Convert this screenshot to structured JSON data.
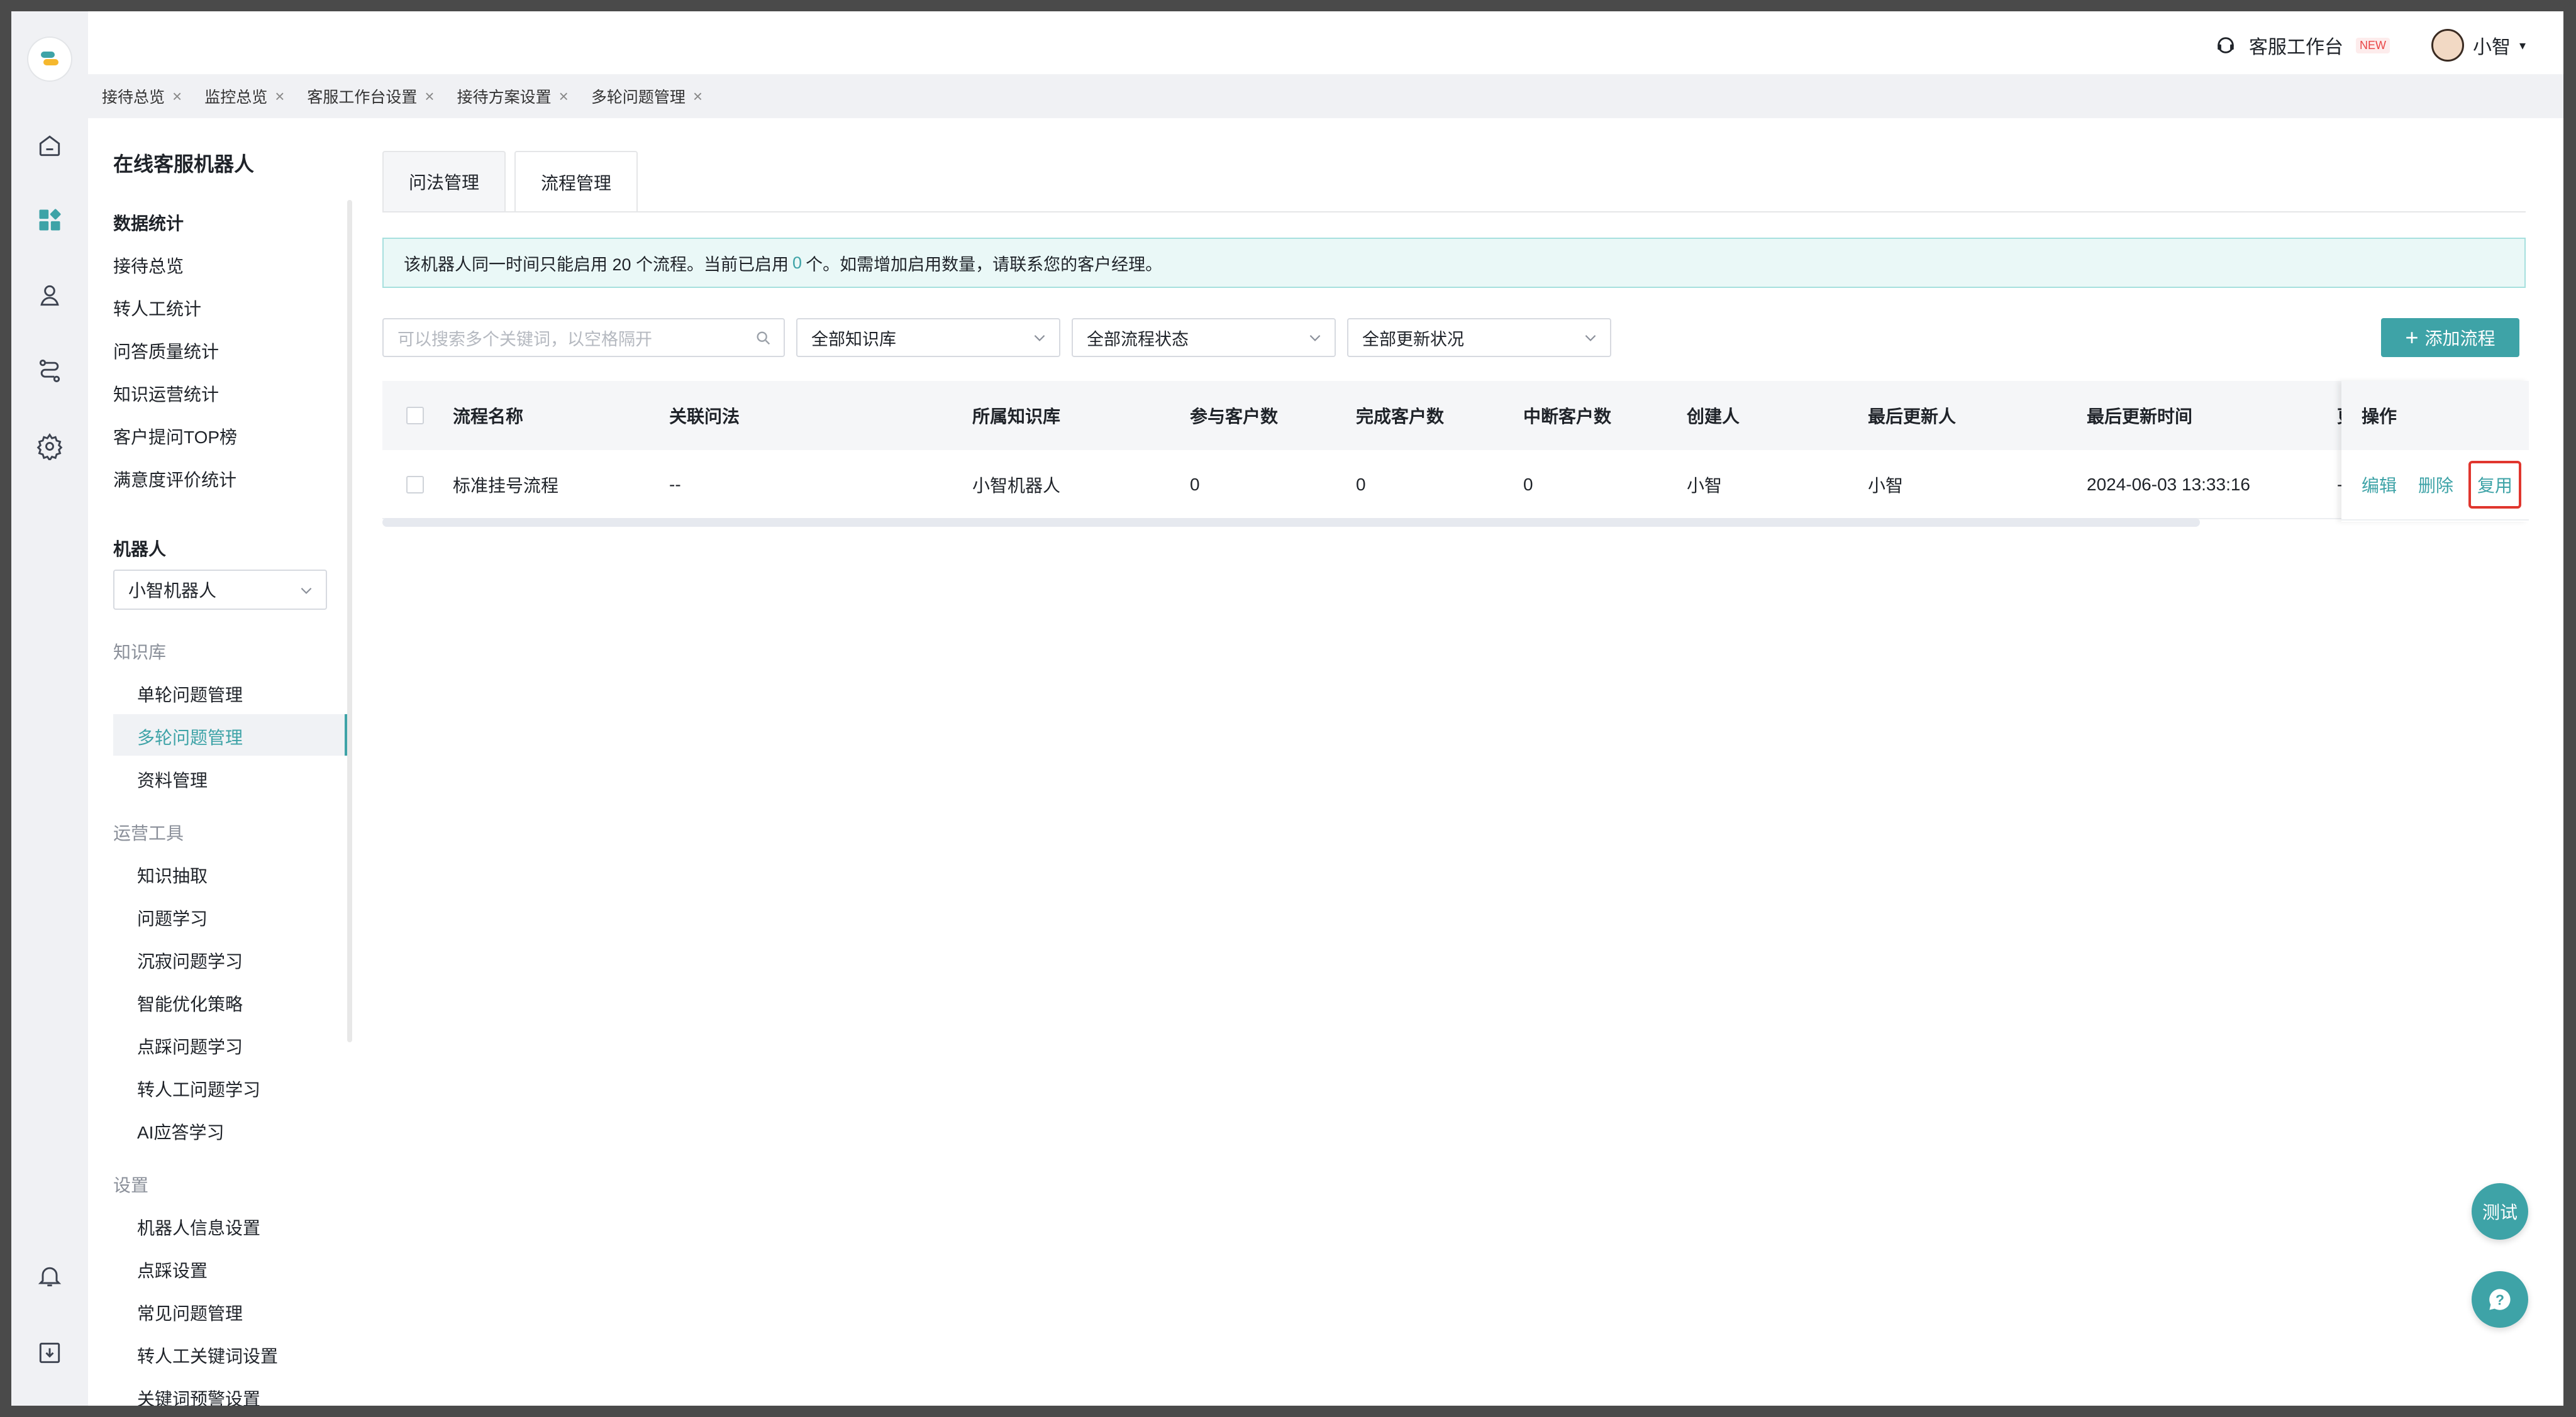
{
  "topbar": {
    "workspace_label": "客服工作台",
    "new_badge": "NEW",
    "user_name": "小智"
  },
  "tabs": [
    {
      "label": "接待总览"
    },
    {
      "label": "监控总览"
    },
    {
      "label": "客服工作台设置"
    },
    {
      "label": "接待方案设置"
    },
    {
      "label": "多轮问题管理"
    }
  ],
  "sidebar": {
    "title": "在线客服机器人",
    "stats_header": "数据统计",
    "stats_items": [
      "接待总览",
      "转人工统计",
      "问答质量统计",
      "知识运营统计",
      "客户提问TOP榜",
      "满意度评价统计"
    ],
    "robot_header": "机器人",
    "robot_select": "小智机器人",
    "kb_group": "知识库",
    "kb_items": [
      "单轮问题管理",
      "多轮问题管理",
      "资料管理"
    ],
    "ops_group": "运营工具",
    "ops_items": [
      "知识抽取",
      "问题学习",
      "沉寂问题学习",
      "智能优化策略",
      "点踩问题学习",
      "转人工问题学习",
      "AI应答学习"
    ],
    "settings_group": "设置",
    "settings_items": [
      "机器人信息设置",
      "点踩设置",
      "常见问题管理",
      "转人工关键词设置",
      "关键词预警设置"
    ]
  },
  "main": {
    "tabs": [
      "问法管理",
      "流程管理"
    ],
    "alert": {
      "prefix": "该机器人同一时间只能启用 20 个流程。当前已启用",
      "count": "0",
      "suffix": "个。如需增加启用数量，请联系您的客户经理。"
    },
    "search_placeholder": "可以搜索多个关键词，以空格隔开",
    "filters": [
      "全部知识库",
      "全部流程状态",
      "全部更新状况"
    ],
    "add_button": "添加流程",
    "columns": [
      "流程名称",
      "关联问法",
      "所属知识库",
      "参与客户数",
      "完成客户数",
      "中断客户数",
      "创建人",
      "最后更新人",
      "最后更新时间",
      "更"
    ],
    "ops_header": "操作",
    "rows": [
      {
        "name": "标准挂号流程",
        "question": "--",
        "kb": "小智机器人",
        "joined": "0",
        "completed": "0",
        "interrupted": "0",
        "creator": "小智",
        "updater": "小智",
        "updated_at": "2024-06-03 13:33:16",
        "more": "--",
        "ops": [
          "编辑",
          "删除",
          "复用"
        ]
      }
    ]
  },
  "fab": {
    "test_label": "测试",
    "help_icon": "question-icon"
  },
  "colors": {
    "accent": "#3ea3a7",
    "highlight": "#e0362e"
  }
}
